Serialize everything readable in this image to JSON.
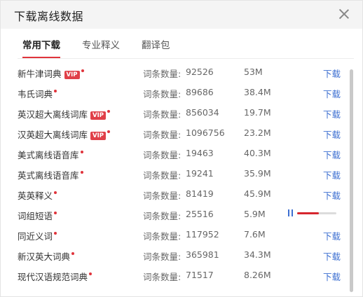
{
  "window": {
    "title": "下载离线数据"
  },
  "tabs": [
    {
      "label": "常用下载",
      "active": true
    },
    {
      "label": "专业释义",
      "active": false
    },
    {
      "label": "翻译包",
      "active": false
    }
  ],
  "count_label": "词条数量:",
  "download_label": "下载",
  "vip_label": "VIP",
  "items": [
    {
      "name": "新牛津词典",
      "vip": true,
      "count": "92526",
      "size": "53M"
    },
    {
      "name": "韦氏词典",
      "vip": false,
      "count": "89686",
      "size": "38.4M"
    },
    {
      "name": "英汉超大离线词库",
      "vip": true,
      "count": "856034",
      "size": "19.7M"
    },
    {
      "name": "汉英超大离线词库",
      "vip": true,
      "count": "1096756",
      "size": "23.2M"
    },
    {
      "name": "美式离线语音库",
      "vip": false,
      "count": "19463",
      "size": "40.3M"
    },
    {
      "name": "英式离线语音库",
      "vip": false,
      "count": "19241",
      "size": "35.9M"
    },
    {
      "name": "英英释义",
      "vip": false,
      "count": "81419",
      "size": "45.9M"
    },
    {
      "name": "词组短语",
      "vip": false,
      "count": "25516",
      "size": "5.9M",
      "downloading": true,
      "progress": 0.55
    },
    {
      "name": "同近义词",
      "vip": false,
      "count": "117952",
      "size": "7.6M"
    },
    {
      "name": "新汉英大词典",
      "vip": false,
      "count": "365981",
      "size": "34.3M"
    },
    {
      "name": "现代汉语规范词典",
      "vip": false,
      "count": "71517",
      "size": "8.26M"
    }
  ],
  "colors": {
    "accent": "#e0343c",
    "link": "#3d6fd1",
    "vip_badge": "#e04048"
  }
}
